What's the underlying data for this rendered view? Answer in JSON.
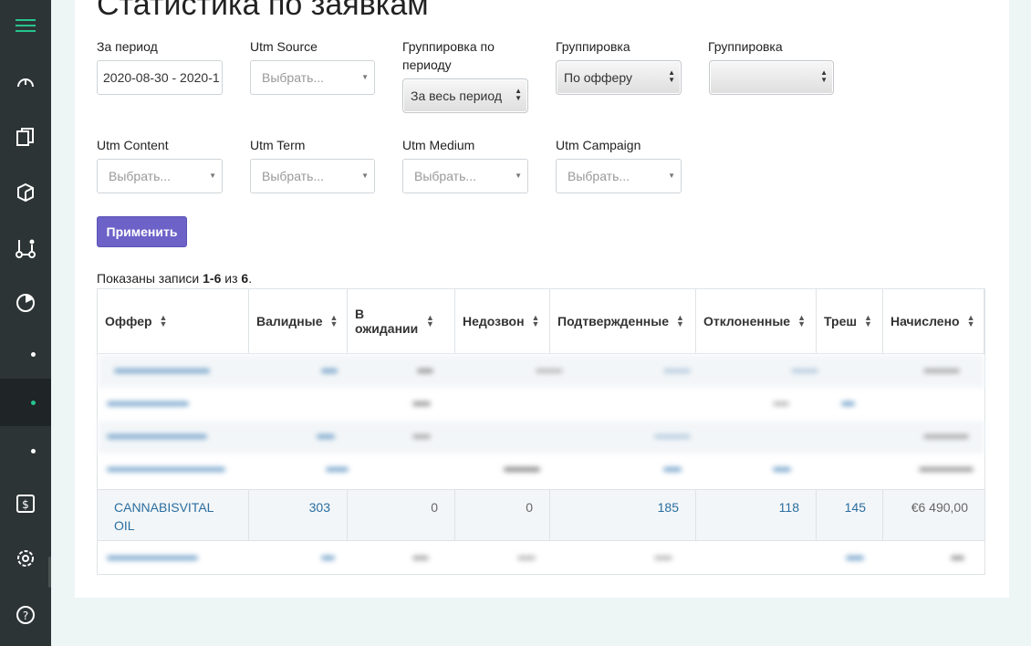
{
  "sidebar": {
    "items": [
      {
        "icon": "menu-icon",
        "active": false
      },
      {
        "icon": "dashboard-gauge-icon",
        "active": false
      },
      {
        "icon": "documents-icon",
        "active": false
      },
      {
        "icon": "box-icon",
        "active": false
      },
      {
        "icon": "flow-icon",
        "active": false
      },
      {
        "icon": "pie-chart-icon",
        "active": false
      },
      {
        "icon": "dot-icon",
        "active": false
      },
      {
        "icon": "dot-icon",
        "active": true
      },
      {
        "icon": "dot-icon",
        "active": false
      },
      {
        "icon": "finance-icon",
        "active": false
      },
      {
        "icon": "settings-icon",
        "active": false
      },
      {
        "icon": "help-icon",
        "active": false
      }
    ],
    "accent": "#27c48e"
  },
  "page": {
    "title": "Статистика по заявкам"
  },
  "filters": {
    "period": {
      "label": "За период",
      "value": "2020-08-30 - 2020-1"
    },
    "utm_source": {
      "label": "Utm Source",
      "placeholder": "Выбрать..."
    },
    "group_period": {
      "label": "Группировка по периоду",
      "value": "За весь период"
    },
    "group1": {
      "label": "Группировка",
      "value": "По офферу"
    },
    "group2": {
      "label": "Группировка",
      "value": ""
    },
    "utm_content": {
      "label": "Utm Content",
      "placeholder": "Выбрать..."
    },
    "utm_term": {
      "label": "Utm Term",
      "placeholder": "Выбрать..."
    },
    "utm_medium": {
      "label": "Utm Medium",
      "placeholder": "Выбрать..."
    },
    "utm_campaign": {
      "label": "Utm Campaign",
      "placeholder": "Выбрать..."
    },
    "apply_label": "Применить"
  },
  "summary": {
    "prefix": "Показаны записи ",
    "range": "1-6",
    "middle": " из ",
    "total": "6",
    "suffix": "."
  },
  "table": {
    "columns": [
      "Оффер",
      "Валидные",
      "В ожидании",
      "Недозвон",
      "Подтвержденные",
      "Отклоненные",
      "Треш",
      "Начислено"
    ],
    "visible_row": {
      "offer": "CANNABISVITAL OIL",
      "valid": "303",
      "pending": "0",
      "no_answer": "0",
      "confirmed": "185",
      "rejected": "118",
      "trash": "145",
      "accrued": "€6 490,00"
    }
  },
  "colors": {
    "primary_button": "#6c62c8",
    "link": "#2a6ea0",
    "sidebar_bg": "#2d3435"
  }
}
